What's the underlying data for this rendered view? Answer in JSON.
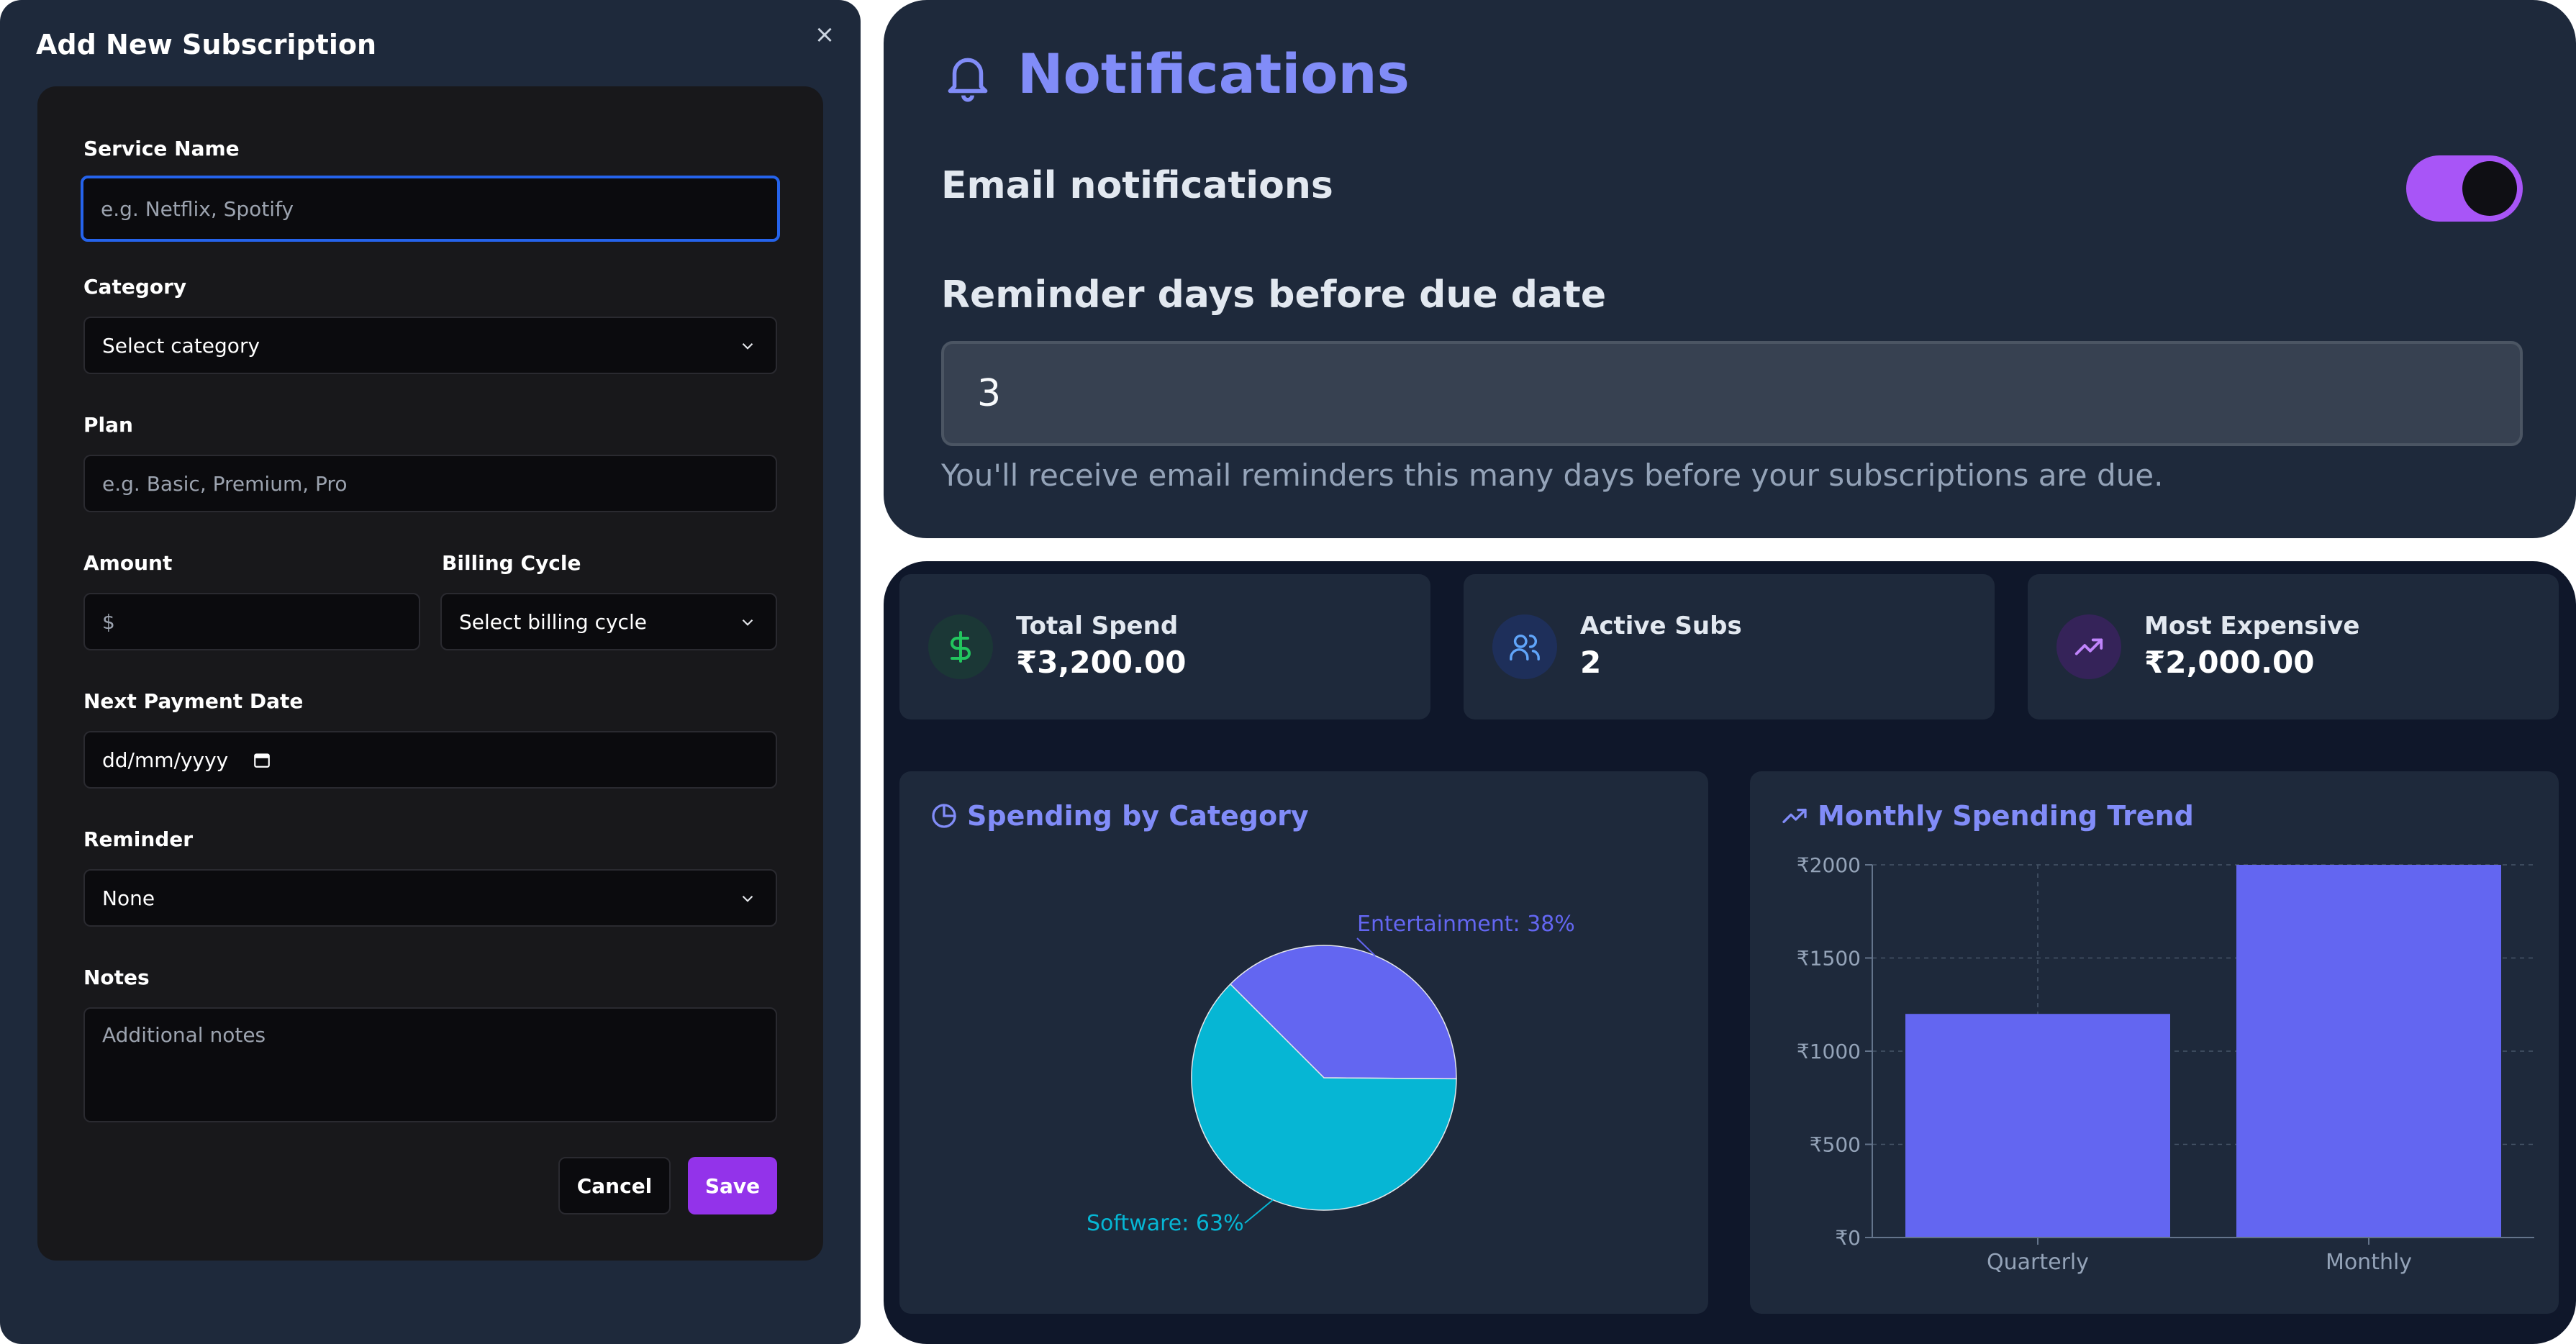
{
  "modal": {
    "title": "Add New Subscription",
    "close": "×",
    "fields": {
      "service_name": {
        "label": "Service Name",
        "placeholder": "e.g. Netflix, Spotify"
      },
      "category": {
        "label": "Category",
        "value": "Select category"
      },
      "plan": {
        "label": "Plan",
        "placeholder": "e.g. Basic, Premium, Pro"
      },
      "amount": {
        "label": "Amount",
        "placeholder": "$"
      },
      "billing_cycle": {
        "label": "Billing Cycle",
        "value": "Select billing cycle"
      },
      "next_payment": {
        "label": "Next Payment Date",
        "placeholder": "dd/mm/yyyy"
      },
      "reminder": {
        "label": "Reminder",
        "value": "None"
      },
      "notes": {
        "label": "Notes",
        "placeholder": "Additional notes"
      }
    },
    "buttons": {
      "cancel": "Cancel",
      "save": "Save"
    }
  },
  "notifications": {
    "title": "Notifications",
    "email_label": "Email notifications",
    "email_enabled": true,
    "reminder_label": "Reminder days before due date",
    "reminder_value": "3",
    "reminder_help": "You'll receive email reminders this many days before your subscriptions are due."
  },
  "stats": [
    {
      "label": "Total Spend",
      "value": "₹3,200.00",
      "icon": "dollar-icon",
      "color": "#22c55e"
    },
    {
      "label": "Active Subs",
      "value": "2",
      "icon": "users-icon",
      "color": "#60a5fa"
    },
    {
      "label": "Most Expensive",
      "value": "₹2,000.00",
      "icon": "trending-up-icon",
      "color": "#c084fc"
    }
  ],
  "charts": {
    "pie_title": "Spending by Category",
    "bar_title": "Monthly Spending Trend"
  },
  "chart_data": [
    {
      "type": "pie",
      "title": "Spending by Category",
      "slices": [
        {
          "label": "Entertainment",
          "value": 38,
          "label_text": "Entertainment: 38%",
          "color": "#6366f1"
        },
        {
          "label": "Software",
          "value": 63,
          "label_text": "Software: 63%",
          "color": "#06b6d4"
        }
      ]
    },
    {
      "type": "bar",
      "title": "Monthly Spending Trend",
      "categories": [
        "Quarterly",
        "Monthly"
      ],
      "values": [
        1200,
        2000
      ],
      "ylim": [
        0,
        2000
      ],
      "yticks": [
        0,
        500,
        1000,
        1500,
        2000
      ],
      "ytick_labels": [
        "₹0",
        "₹500",
        "₹1000",
        "₹1500",
        "₹2000"
      ],
      "grid": true,
      "color": "#6366f1"
    }
  ]
}
